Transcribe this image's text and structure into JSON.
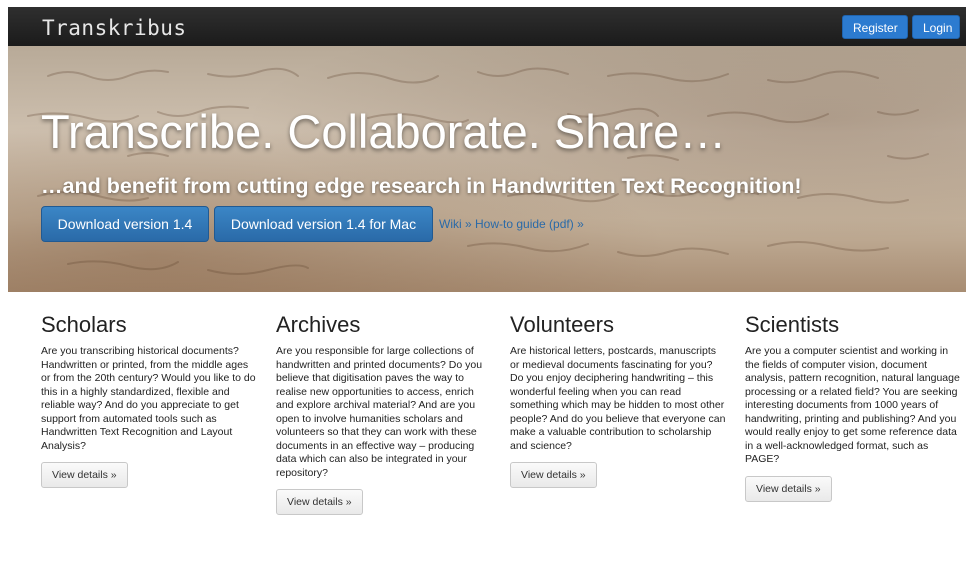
{
  "navbar": {
    "brand": "Transkribus",
    "register_label": "Register",
    "login_label": "Login"
  },
  "hero": {
    "title": "Transcribe. Collaborate. Share…",
    "subtitle": "…and benefit from cutting edge research in Handwritten Text Recognition!",
    "download_label": "Download version 1.4",
    "download_mac_label": "Download version 1.4 for Mac",
    "wiki_label": "Wiki »",
    "howto_label": "How-to guide (pdf) »"
  },
  "columns": [
    {
      "title": "Scholars",
      "text": "Are you transcribing historical documents? Handwritten or printed, from the middle ages or from the 20th century? Would you like to do this in a highly standardized, flexible and reliable way? And do you appreciate to get support from automated tools such as Handwritten Text Recognition and Layout Analysis?",
      "button": "View details »"
    },
    {
      "title": "Archives",
      "text": "Are you responsible for large collections of handwritten and printed documents? Do you believe that digitisation paves the way to realise new opportunities to access, enrich and explore archival material? And are you open to involve humanities scholars and volunteers so that they can work with these documents in an effective way – producing data which can also be integrated in your repository?",
      "button": "View details »"
    },
    {
      "title": "Volunteers",
      "text": "Are historical letters, postcards, manuscripts or medieval documents fascinating for you? Do you enjoy deciphering handwriting – this wonderful feeling when you can read something which may be hidden to most other people? And do you believe that everyone can make a valuable contribution to scholarship and science?",
      "button": "View details »"
    },
    {
      "title": "Scientists",
      "text": "Are you a computer scientist and working in the fields of computer vision, document analysis, pattern recognition, natural language processing or a related field? You are seeking interesting documents from 1000 years of handwriting, printing and publishing? And you would really enjoy to get some reference data in a well-acknowledged format, such as PAGE?",
      "button": "View details »"
    }
  ]
}
